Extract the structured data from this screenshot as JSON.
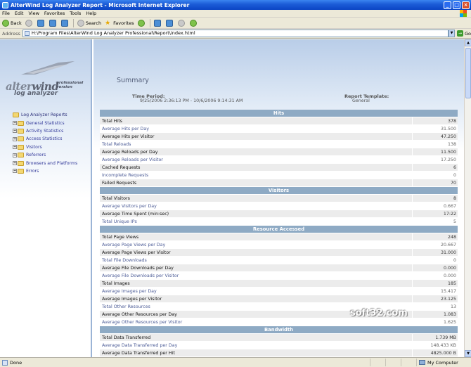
{
  "window": {
    "title": "AlterWind Log Analyzer Report - Microsoft Internet Explorer"
  },
  "menu": [
    "File",
    "Edit",
    "View",
    "Favorites",
    "Tools",
    "Help"
  ],
  "toolbar": {
    "back": "Back",
    "search": "Search",
    "favorites": "Favorites"
  },
  "address": {
    "label": "Address",
    "value": "H:\\Program Files\\AlterWind Log Analyzer Professional\\Report\\index.html",
    "go": "Go"
  },
  "logo": {
    "brand_alter": "alter",
    "brand_wind": "wind",
    "edition": "professional",
    "version_word": "version",
    "subtitle": "log analyzer"
  },
  "tree": {
    "root": "Log Analyzer Reports",
    "items": [
      "General Statistics",
      "Activity Statistics",
      "Access Statistics",
      "Visitors",
      "Referrers",
      "Browsers and Platforms",
      "Errors"
    ]
  },
  "report": {
    "heading": "Summary",
    "time_period_label": "Time Period:",
    "time_period_value": "9/25/2006 2:36:13 PM - 10/6/2006 9:14:31 AM",
    "template_label": "Report Template:",
    "template_value": "General"
  },
  "sections": [
    {
      "title": "Hits",
      "rows": [
        [
          "Total Hits",
          "378"
        ],
        [
          "Average Hits per Day",
          "31.500"
        ],
        [
          "Average Hits per Visitor",
          "47.250"
        ],
        [
          "Total Reloads",
          "138"
        ],
        [
          "Average Reloads per Day",
          "11.500"
        ],
        [
          "Average Reloads per Visitor",
          "17.250"
        ],
        [
          "Cached Requests",
          "6"
        ],
        [
          "Incomplete Requests",
          "0"
        ],
        [
          "Failed Requests",
          "70"
        ]
      ]
    },
    {
      "title": "Visitors",
      "rows": [
        [
          "Total Visitors",
          "8"
        ],
        [
          "Average Visitors per Day",
          "0.667"
        ],
        [
          "Average Time Spent (min:sec)",
          "17:22"
        ],
        [
          "Total Unique IPs",
          "5"
        ]
      ]
    },
    {
      "title": "Resource Accessed",
      "rows": [
        [
          "Total Page Views",
          "248"
        ],
        [
          "Average Page Views per Day",
          "20.667"
        ],
        [
          "Average Page Views per Visitor",
          "31.000"
        ],
        [
          "Total File Downloads",
          "0"
        ],
        [
          "Average File Downloads per Day",
          "0.000"
        ],
        [
          "Average File Downloads per Visitor",
          "0.000"
        ],
        [
          "Total Images",
          "185"
        ],
        [
          "Average Images per Day",
          "15.417"
        ],
        [
          "Average Images per Visitor",
          "23.125"
        ],
        [
          "Total Other Resources",
          "13"
        ],
        [
          "Average Other Resources per Day",
          "1.083"
        ],
        [
          "Average Other Resources per Visitor",
          "1.625"
        ]
      ]
    },
    {
      "title": "Bandwidth",
      "rows": [
        [
          "Total Data Transferred",
          "1.739 MB"
        ],
        [
          "Average Data Transferred per Day",
          "148.433 KB"
        ],
        [
          "Average Data Transferred per Hit",
          "4825.000 B"
        ]
      ]
    }
  ],
  "watermark": "soft32.com",
  "status": {
    "text": "Done",
    "zone": "My Computer"
  },
  "colors": {
    "section_header": "#8eaac4",
    "row_shaded": "#ececec",
    "link_text": "#4b5b96",
    "titlebar": "#0a44c4"
  }
}
